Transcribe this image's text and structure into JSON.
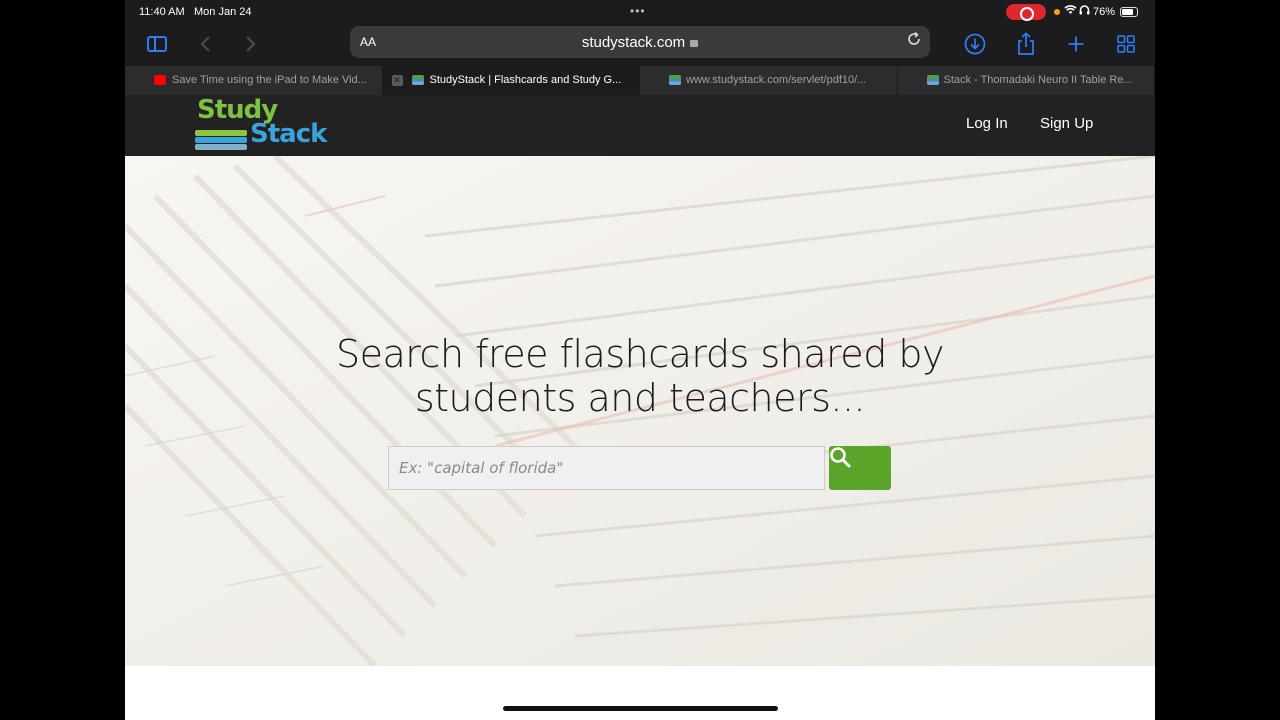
{
  "status": {
    "time": "11:40 AM",
    "date": "Mon Jan 24",
    "battery": "76%"
  },
  "toolbar": {
    "text_size": "AA",
    "url": "studystack.com"
  },
  "tabs": [
    {
      "label": "Save Time using the iPad to Make Vid..."
    },
    {
      "label": "StudyStack | Flashcards and Study G..."
    },
    {
      "label": "www.studystack.com/servlet/pdf10/..."
    },
    {
      "label": "Stack - Thomadaki Neuro II Table Re..."
    }
  ],
  "site": {
    "logo_top": "Study",
    "logo_bottom": "Stack",
    "login": "Log In",
    "signup": "Sign Up",
    "hero_line1": "Search free flashcards shared by",
    "hero_line2": "students and teachers...",
    "search_placeholder": "Ex: \"capital of florida\""
  },
  "colors": {
    "accent": "#2f7cf6",
    "search_button": "#5aa52a",
    "logo_green": "#7dc242",
    "logo_blue": "#3aa3dc"
  }
}
